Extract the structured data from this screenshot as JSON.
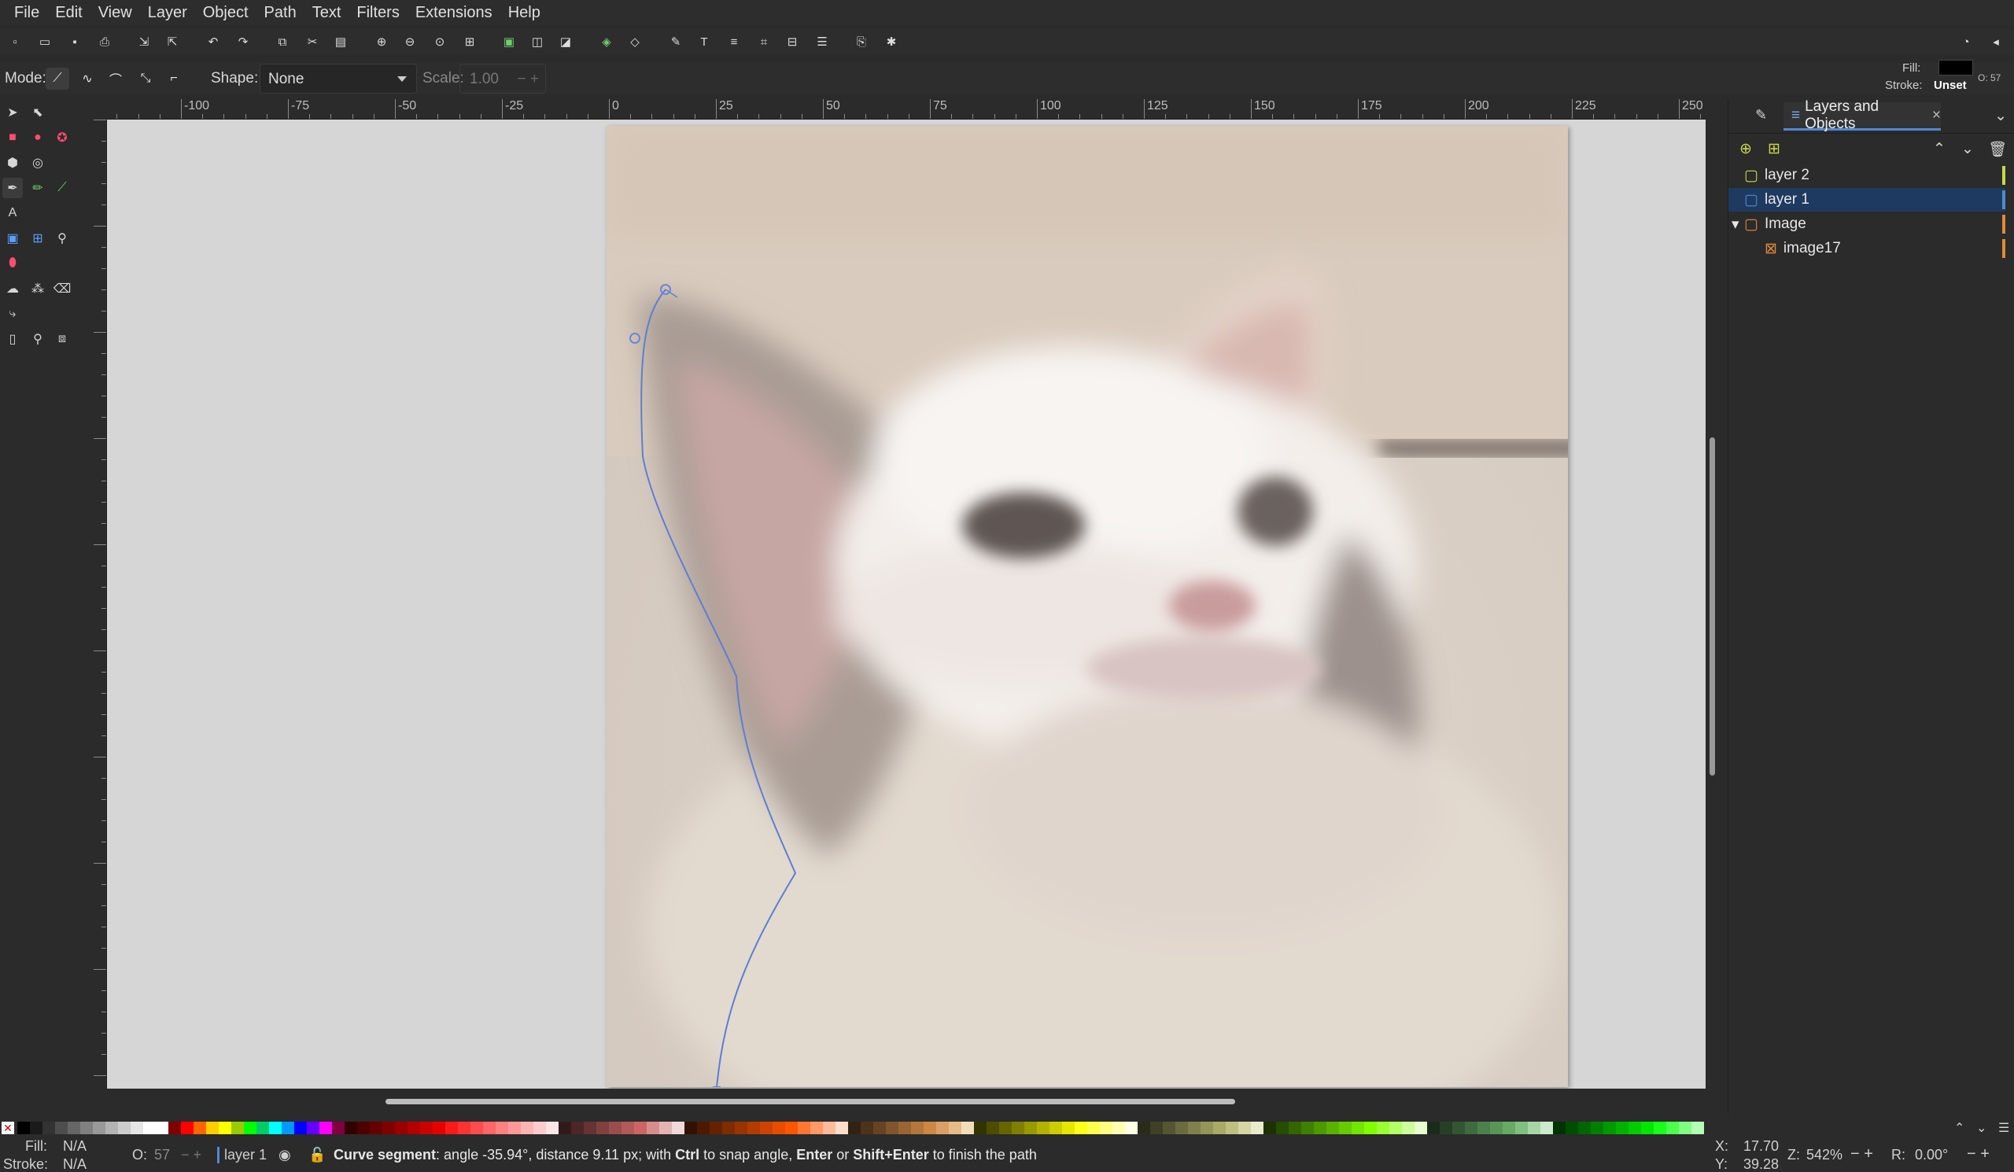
{
  "menu": [
    "File",
    "Edit",
    "View",
    "Layer",
    "Object",
    "Path",
    "Text",
    "Filters",
    "Extensions",
    "Help"
  ],
  "tool_controls": {
    "mode_label": "Mode:",
    "shape_label": "Shape:",
    "shape_value": "None",
    "scale_label": "Scale:",
    "scale_value": "1.00"
  },
  "style_indicator": {
    "fill_label": "Fill:",
    "stroke_label": "Stroke:",
    "stroke_value": "Unset",
    "opacity_label": "O:",
    "opacity_value": "57"
  },
  "ruler_top_labels": [
    "-100",
    "-75",
    "-50",
    "-25",
    "0",
    "25",
    "50",
    "75",
    "100",
    "125",
    "150",
    "175",
    "200",
    "225",
    "250"
  ],
  "panel": {
    "tab_title": "Layers and Objects",
    "layers": [
      {
        "label": "layer 2",
        "color": "#c8d84a",
        "selected": false,
        "indent": 0
      },
      {
        "label": "layer 1",
        "color": "#4f88d6",
        "selected": true,
        "indent": 0
      },
      {
        "label": "Image",
        "color": "#e08a3a",
        "selected": false,
        "indent": 0,
        "expanded": true
      },
      {
        "label": "image17",
        "color": "#e08a3a",
        "selected": false,
        "indent": 1
      }
    ]
  },
  "status": {
    "fill_label": "Fill:",
    "fill_value": "N/A",
    "stroke_label": "Stroke:",
    "stroke_value": "N/A",
    "opacity_label": "O:",
    "opacity_value": "57",
    "layer_name": "layer 1",
    "message_bold": "Curve segment",
    "message_rest": ": angle -35.94°, distance 9.11 px; with ",
    "key_ctrl": "Ctrl",
    "message_mid": " to snap angle, ",
    "key_enter": "Enter",
    "message_or": " or ",
    "key_shift_enter": "Shift+Enter",
    "message_end": " to finish the path",
    "x_label": "X:",
    "x_value": "17.70",
    "y_label": "Y:",
    "y_value": "39.28",
    "zoom_label": "Z:",
    "zoom_value": "542%",
    "rotate_label": "R:",
    "rotate_value": "0.00°"
  },
  "palette_colors": [
    "#000000",
    "#1a1a1a",
    "#333333",
    "#4d4d4d",
    "#666666",
    "#808080",
    "#999999",
    "#b3b3b3",
    "#cccccc",
    "#e6e6e6",
    "#ffffff",
    "#ffffff",
    "#800000",
    "#ff0000",
    "#ff6600",
    "#ffcc00",
    "#ffff00",
    "#99cc00",
    "#00ff00",
    "#00cc66",
    "#00ffff",
    "#0099ff",
    "#0000ff",
    "#6600ff",
    "#ff00ff",
    "#800040",
    "#330000",
    "#4d0000",
    "#660000",
    "#800000",
    "#990000",
    "#b30000",
    "#cc0000",
    "#e60000",
    "#ff1a1a",
    "#ff3333",
    "#ff4d4d",
    "#ff6666",
    "#ff8080",
    "#ff9999",
    "#ffb3b3",
    "#ffcccc",
    "#ffe6e6",
    "#331a1a",
    "#4d2626",
    "#663333",
    "#804040",
    "#994d4d",
    "#b35959",
    "#cc6666",
    "#d98c8c",
    "#e6b3b3",
    "#f2d9d9",
    "#331100",
    "#4d1a00",
    "#662200",
    "#802b00",
    "#993300",
    "#b33c00",
    "#cc4400",
    "#e64d00",
    "#ff5500",
    "#ff7733",
    "#ff9966",
    "#ffbb99",
    "#ffddcc",
    "#332211",
    "#4d331a",
    "#664422",
    "#80552b",
    "#996633",
    "#b3773c",
    "#cc8844",
    "#d9a066",
    "#e6bb88",
    "#f2ddbb",
    "#333300",
    "#4d4d00",
    "#666600",
    "#808000",
    "#999900",
    "#b3b300",
    "#cccc00",
    "#e6e600",
    "#ffff1a",
    "#ffff4d",
    "#ffff80",
    "#ffffb3",
    "#ffffe6",
    "#2b2b1a",
    "#404026",
    "#555533",
    "#6b6b40",
    "#80804d",
    "#959559",
    "#aaaa66",
    "#bfbf80",
    "#d5d5a6",
    "#eaeacc",
    "#1a3300",
    "#264d00",
    "#336600",
    "#408000",
    "#4d9900",
    "#59b300",
    "#66cc00",
    "#73e600",
    "#80ff00",
    "#99ff33",
    "#b3ff66",
    "#ccff99",
    "#e6ffcc",
    "#1a2b1a",
    "#264026",
    "#335533",
    "#406b40",
    "#4d804d",
    "#599559",
    "#66aa66",
    "#80bf80",
    "#a6d5a6",
    "#cceacc",
    "#003300",
    "#004d00",
    "#006600",
    "#008000",
    "#009900",
    "#00b300",
    "#00cc00",
    "#00e600",
    "#1aff1a",
    "#4dff4d",
    "#80ff80",
    "#b3ffb3"
  ]
}
